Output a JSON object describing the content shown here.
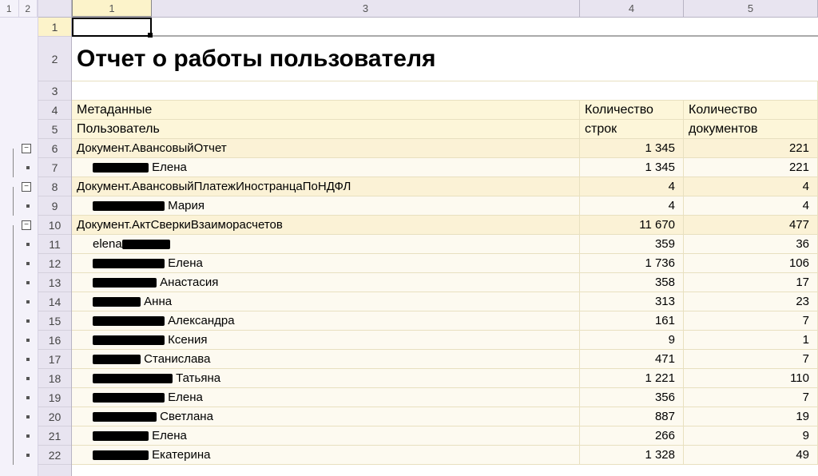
{
  "outline_levels": [
    "1",
    "2"
  ],
  "col_headers": {
    "c1": "1",
    "c3": "3",
    "c4": "4",
    "c5": "5"
  },
  "row_numbers": [
    "1",
    "2",
    "3",
    "4",
    "5",
    "6",
    "7",
    "8",
    "9",
    "10",
    "11",
    "12",
    "13",
    "14",
    "15",
    "16",
    "17",
    "18",
    "19",
    "20",
    "21",
    "22"
  ],
  "title": "Отчет о работы пользователя",
  "header": {
    "metadata_label": "Метаданные",
    "user_label": "Пользователь",
    "count_rows_label_1": "Количество",
    "count_rows_label_2": "строк",
    "count_docs_label_1": "Количество",
    "count_docs_label_2": "документов"
  },
  "rows": [
    {
      "kind": "grp",
      "name": "Документ.АвансовыйОтчет",
      "rows": "1 345",
      "docs": "221"
    },
    {
      "kind": "det",
      "name": "Елена",
      "redact_w": 70,
      "rows": "1 345",
      "docs": "221"
    },
    {
      "kind": "grp",
      "name": "Документ.АвансовыйПлатежИностранцаПоНДФЛ",
      "rows": "4",
      "docs": "4"
    },
    {
      "kind": "det",
      "name": "Мария",
      "redact_w": 90,
      "rows": "4",
      "docs": "4"
    },
    {
      "kind": "grp",
      "name": "Документ.АктСверкиВзаиморасчетов",
      "rows": "11 670",
      "docs": "477"
    },
    {
      "kind": "det",
      "name": "",
      "name_prefix": "elena",
      "redact_w": 60,
      "rows": "359",
      "docs": "36"
    },
    {
      "kind": "det",
      "name": "Елена",
      "redact_w": 90,
      "rows": "1 736",
      "docs": "106"
    },
    {
      "kind": "det",
      "name": "Анастасия",
      "redact_w": 80,
      "rows": "358",
      "docs": "17"
    },
    {
      "kind": "det",
      "name": "Анна",
      "redact_w": 60,
      "rows": "313",
      "docs": "23"
    },
    {
      "kind": "det",
      "name": "Александра",
      "redact_w": 90,
      "rows": "161",
      "docs": "7"
    },
    {
      "kind": "det",
      "name": "Ксения",
      "redact_w": 90,
      "rows": "9",
      "docs": "1"
    },
    {
      "kind": "det",
      "name": "Станислава",
      "redact_w": 60,
      "rows": "471",
      "docs": "7"
    },
    {
      "kind": "det",
      "name": "Татьяна",
      "redact_w": 100,
      "rows": "1 221",
      "docs": "110"
    },
    {
      "kind": "det",
      "name": "Елена",
      "redact_w": 90,
      "rows": "356",
      "docs": "7"
    },
    {
      "kind": "det",
      "name": "Светлана",
      "redact_w": 80,
      "rows": "887",
      "docs": "19"
    },
    {
      "kind": "det",
      "name": "Елена",
      "redact_w": 70,
      "rows": "266",
      "docs": "9"
    },
    {
      "kind": "det",
      "name": "Екатерина",
      "redact_w": 70,
      "rows": "1 328",
      "docs": "49"
    }
  ]
}
